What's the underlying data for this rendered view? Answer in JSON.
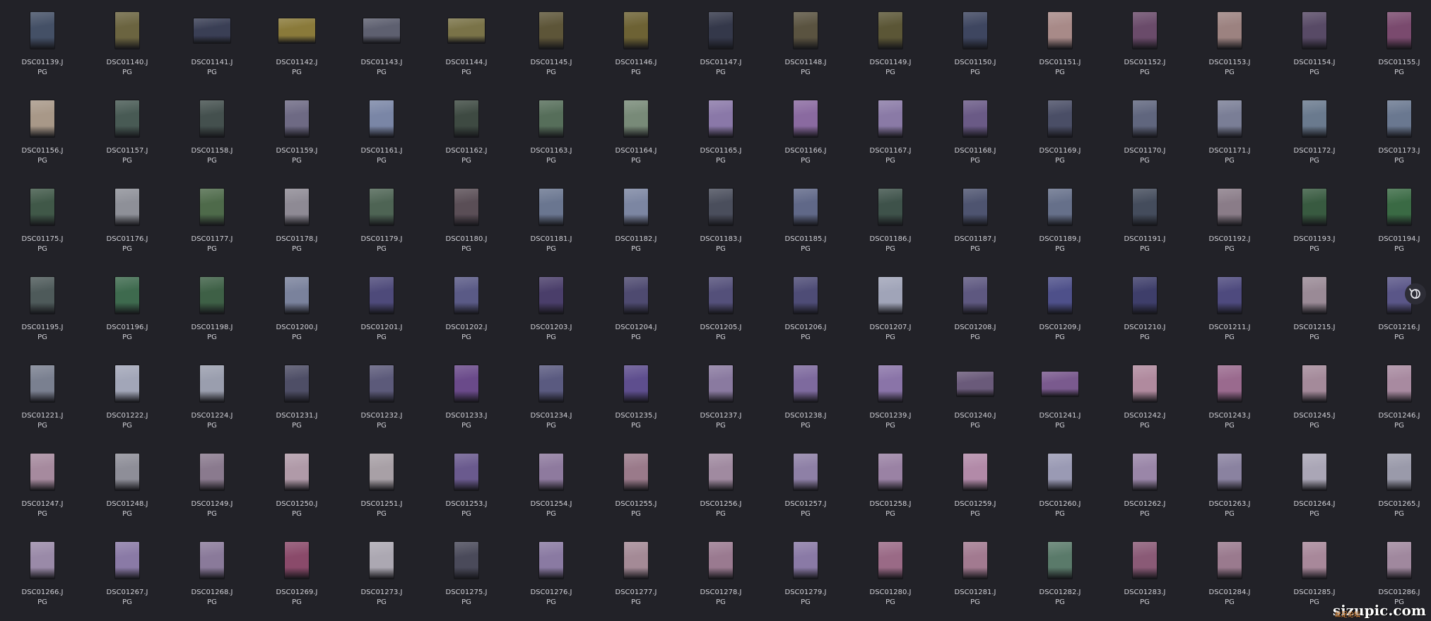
{
  "gallery": {
    "files": [
      {
        "name": "DSC01139.JPG",
        "tone": "#445066"
      },
      {
        "name": "DSC01140.JPG",
        "tone": "#6b6440"
      },
      {
        "name": "DSC01141.JPG",
        "tone": "#3a3f55",
        "wide": true
      },
      {
        "name": "DSC01142.JPG",
        "tone": "#8a7a3a",
        "wide": true
      },
      {
        "name": "DSC01143.JPG",
        "tone": "#5e6070",
        "wide": true
      },
      {
        "name": "DSC01144.JPG",
        "tone": "#7a7348",
        "wide": true
      },
      {
        "name": "DSC01145.JPG",
        "tone": "#5d5538"
      },
      {
        "name": "DSC01146.JPG",
        "tone": "#6d6234"
      },
      {
        "name": "DSC01147.JPG",
        "tone": "#34384a"
      },
      {
        "name": "DSC01148.JPG",
        "tone": "#5a5340"
      },
      {
        "name": "DSC01149.JPG",
        "tone": "#5b5636"
      },
      {
        "name": "DSC01150.JPG",
        "tone": "#3e4660"
      },
      {
        "name": "DSC01151.JPG",
        "tone": "#a88a88"
      },
      {
        "name": "DSC01152.JPG",
        "tone": "#6a4b6a"
      },
      {
        "name": "DSC01153.JPG",
        "tone": "#9c8280"
      },
      {
        "name": "DSC01154.JPG",
        "tone": "#584a66"
      },
      {
        "name": "DSC01155.JPG",
        "tone": "#7a4a6e"
      },
      {
        "name": "DSC01156.JPG",
        "tone": "#a89888"
      },
      {
        "name": "DSC01157.JPG",
        "tone": "#485a54"
      },
      {
        "name": "DSC01158.JPG",
        "tone": "#44504e"
      },
      {
        "name": "DSC01159.JPG",
        "tone": "#6e6a84"
      },
      {
        "name": "DSC01161.JPG",
        "tone": "#7a86a6"
      },
      {
        "name": "DSC01162.JPG",
        "tone": "#3e4a42"
      },
      {
        "name": "DSC01163.JPG",
        "tone": "#566e5a"
      },
      {
        "name": "DSC01164.JPG",
        "tone": "#788a78"
      },
      {
        "name": "DSC01165.JPG",
        "tone": "#8a78a8"
      },
      {
        "name": "DSC01166.JPG",
        "tone": "#8a6aa0"
      },
      {
        "name": "DSC01167.JPG",
        "tone": "#8a7aa6"
      },
      {
        "name": "DSC01168.JPG",
        "tone": "#6a5a86"
      },
      {
        "name": "DSC01169.JPG",
        "tone": "#4a4e66"
      },
      {
        "name": "DSC01170.JPG",
        "tone": "#60667e"
      },
      {
        "name": "DSC01171.JPG",
        "tone": "#7a7e96"
      },
      {
        "name": "DSC01172.JPG",
        "tone": "#6a7a8e"
      },
      {
        "name": "DSC01173.JPG",
        "tone": "#6a7890"
      },
      {
        "name": "DSC01175.JPG",
        "tone": "#405848"
      },
      {
        "name": "DSC01176.JPG",
        "tone": "#8e9098"
      },
      {
        "name": "DSC01177.JPG",
        "tone": "#4e6a4a"
      },
      {
        "name": "DSC01178.JPG",
        "tone": "#8e8a94"
      },
      {
        "name": "DSC01179.JPG",
        "tone": "#4e6454"
      },
      {
        "name": "DSC01180.JPG",
        "tone": "#5a4e56"
      },
      {
        "name": "DSC01181.JPG",
        "tone": "#6a7690"
      },
      {
        "name": "DSC01182.JPG",
        "tone": "#7c86a2"
      },
      {
        "name": "DSC01183.JPG",
        "tone": "#4a4e5c"
      },
      {
        "name": "DSC01185.JPG",
        "tone": "#606888"
      },
      {
        "name": "DSC01186.JPG",
        "tone": "#3e524a"
      },
      {
        "name": "DSC01187.JPG",
        "tone": "#4e5470"
      },
      {
        "name": "DSC01189.JPG",
        "tone": "#66708a"
      },
      {
        "name": "DSC01191.JPG",
        "tone": "#444c5c"
      },
      {
        "name": "DSC01192.JPG",
        "tone": "#8a7c88"
      },
      {
        "name": "DSC01193.JPG",
        "tone": "#385a40"
      },
      {
        "name": "DSC01194.JPG",
        "tone": "#3a6a44"
      },
      {
        "name": "DSC01195.JPG",
        "tone": "#4e5a5a"
      },
      {
        "name": "DSC01196.JPG",
        "tone": "#3e6a4e"
      },
      {
        "name": "DSC01198.JPG",
        "tone": "#3e6046"
      },
      {
        "name": "DSC01200.JPG",
        "tone": "#7a829c"
      },
      {
        "name": "DSC01201.JPG",
        "tone": "#4e4a7a"
      },
      {
        "name": "DSC01202.JPG",
        "tone": "#5a5a86"
      },
      {
        "name": "DSC01203.JPG",
        "tone": "#4a3e6a"
      },
      {
        "name": "DSC01204.JPG",
        "tone": "#4e4a70"
      },
      {
        "name": "DSC01205.JPG",
        "tone": "#54507a"
      },
      {
        "name": "DSC01206.JPG",
        "tone": "#4e4c76"
      },
      {
        "name": "DSC01207.JPG",
        "tone": "#a0a4b8"
      },
      {
        "name": "DSC01208.JPG",
        "tone": "#5e5880"
      },
      {
        "name": "DSC01209.JPG",
        "tone": "#4e508a"
      },
      {
        "name": "DSC01210.JPG",
        "tone": "#3e3e6a"
      },
      {
        "name": "DSC01211.JPG",
        "tone": "#4e4a7e"
      },
      {
        "name": "DSC01215.JPG",
        "tone": "#9a8a96"
      },
      {
        "name": "DSC01216.JPG",
        "tone": "#5a5688"
      },
      {
        "name": "DSC01221.JPG",
        "tone": "#7a8090"
      },
      {
        "name": "DSC01222.JPG",
        "tone": "#a2a6b8"
      },
      {
        "name": "DSC01224.JPG",
        "tone": "#9a9eae"
      },
      {
        "name": "DSC01231.JPG",
        "tone": "#4e4e66"
      },
      {
        "name": "DSC01232.JPG",
        "tone": "#5c5a7a"
      },
      {
        "name": "DSC01233.JPG",
        "tone": "#6a4a8a"
      },
      {
        "name": "DSC01234.JPG",
        "tone": "#5a5a80"
      },
      {
        "name": "DSC01235.JPG",
        "tone": "#5e4e8e"
      },
      {
        "name": "DSC01237.JPG",
        "tone": "#8a7aa0"
      },
      {
        "name": "DSC01238.JPG",
        "tone": "#7e6a9e"
      },
      {
        "name": "DSC01239.JPG",
        "tone": "#8a74a8"
      },
      {
        "name": "DSC01240.JPG",
        "tone": "#6a5a7a",
        "wide": true
      },
      {
        "name": "DSC01241.JPG",
        "tone": "#7a5a8e",
        "wide": true
      },
      {
        "name": "DSC01242.JPG",
        "tone": "#b08a9e"
      },
      {
        "name": "DSC01243.JPG",
        "tone": "#9a6a8e"
      },
      {
        "name": "DSC01245.JPG",
        "tone": "#a48a9a"
      },
      {
        "name": "DSC01246.JPG",
        "tone": "#a88aa0"
      },
      {
        "name": "DSC01247.JPG",
        "tone": "#a68a9e"
      },
      {
        "name": "DSC01248.JPG",
        "tone": "#8e8e98"
      },
      {
        "name": "DSC01249.JPG",
        "tone": "#8a7a8e"
      },
      {
        "name": "DSC01250.JPG",
        "tone": "#b09aa8"
      },
      {
        "name": "DSC01251.JPG",
        "tone": "#a8a0a6"
      },
      {
        "name": "DSC01253.JPG",
        "tone": "#6a5a8e"
      },
      {
        "name": "DSC01254.JPG",
        "tone": "#8e7a9e"
      },
      {
        "name": "DSC01255.JPG",
        "tone": "#9a7a8a"
      },
      {
        "name": "DSC01256.JPG",
        "tone": "#a08aa0"
      },
      {
        "name": "DSC01257.JPG",
        "tone": "#8e80a6"
      },
      {
        "name": "DSC01258.JPG",
        "tone": "#9a82a4"
      },
      {
        "name": "DSC01259.JPG",
        "tone": "#b28aa8"
      },
      {
        "name": "DSC01260.JPG",
        "tone": "#9a9ab4"
      },
      {
        "name": "DSC01262.JPG",
        "tone": "#9a86a8"
      },
      {
        "name": "DSC01263.JPG",
        "tone": "#8a82a0"
      },
      {
        "name": "DSC01264.JPG",
        "tone": "#aaa6b6"
      },
      {
        "name": "DSC01265.JPG",
        "tone": "#9a9aaa"
      },
      {
        "name": "DSC01266.JPG",
        "tone": "#9a8aa8"
      },
      {
        "name": "DSC01267.JPG",
        "tone": "#8a7aa6"
      },
      {
        "name": "DSC01268.JPG",
        "tone": "#8a7a9a"
      },
      {
        "name": "DSC01269.JPG",
        "tone": "#8a4a6a"
      },
      {
        "name": "DSC01273.JPG",
        "tone": "#aca8b2"
      },
      {
        "name": "DSC01275.JPG",
        "tone": "#4a4a5a"
      },
      {
        "name": "DSC01276.JPG",
        "tone": "#8a7aa2"
      },
      {
        "name": "DSC01277.JPG",
        "tone": "#a48a96"
      },
      {
        "name": "DSC01278.JPG",
        "tone": "#9a7a90"
      },
      {
        "name": "DSC01279.JPG",
        "tone": "#8a7aa6"
      },
      {
        "name": "DSC01280.JPG",
        "tone": "#9a6a86"
      },
      {
        "name": "DSC01281.JPG",
        "tone": "#a27a90"
      },
      {
        "name": "DSC01282.JPG",
        "tone": "#5a7a6a"
      },
      {
        "name": "DSC01283.JPG",
        "tone": "#8a5a76"
      },
      {
        "name": "DSC01284.JPG",
        "tone": "#9a7a8e"
      },
      {
        "name": "DSC01285.JPG",
        "tone": "#a8889a"
      },
      {
        "name": "DSC01286.JPG",
        "tone": "#a0889e"
      }
    ]
  },
  "sidebar_button": {
    "icon": "sync-icon"
  },
  "watermark": {
    "main": "sizupic.com",
    "sub": "丝足论坛"
  }
}
